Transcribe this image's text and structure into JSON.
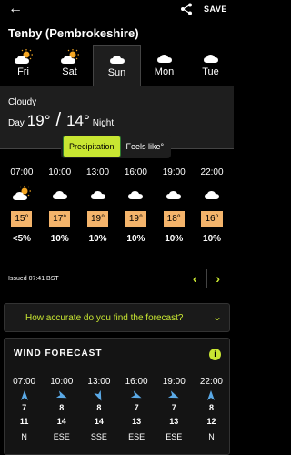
{
  "header": {
    "save_label": "SAVE"
  },
  "location": "Tenby (Pembrokeshire)",
  "days": [
    {
      "label": "Fri",
      "icon": "sun-cloud-icon"
    },
    {
      "label": "Sat",
      "icon": "sun-cloud-icon"
    },
    {
      "label": "Sun",
      "icon": "cloud-icon",
      "active": true
    },
    {
      "label": "Mon",
      "icon": "cloud-icon"
    },
    {
      "label": "Tue",
      "icon": "cloud-icon"
    }
  ],
  "summary": {
    "condition": "Cloudy",
    "day_label": "Day",
    "day_temp": "19°",
    "night_temp": "14°",
    "night_label": "Night"
  },
  "toggle": {
    "precip_label": "Precipitation",
    "feels_label": "Feels like°"
  },
  "hourly": [
    {
      "time": "07:00",
      "icon": "sun-cloud-icon",
      "temp": "15°",
      "precip": "<5%"
    },
    {
      "time": "10:00",
      "icon": "cloud-icon",
      "temp": "17°",
      "precip": "10%"
    },
    {
      "time": "13:00",
      "icon": "cloud-icon",
      "temp": "19°",
      "precip": "10%"
    },
    {
      "time": "16:00",
      "icon": "cloud-icon",
      "temp": "19°",
      "precip": "10%"
    },
    {
      "time": "19:00",
      "icon": "cloud-icon",
      "temp": "18°",
      "precip": "10%"
    },
    {
      "time": "22:00",
      "icon": "cloud-icon",
      "temp": "16°",
      "precip": "10%"
    }
  ],
  "issued": "Issued 07:41 BST",
  "accuracy_prompt": "How accurate do you find the forecast?",
  "wind": {
    "title": "WIND FORECAST",
    "hours": [
      {
        "time": "07:00",
        "speed": "7",
        "gust": "11",
        "dir": "N"
      },
      {
        "time": "10:00",
        "speed": "8",
        "gust": "14",
        "dir": "ESE"
      },
      {
        "time": "13:00",
        "speed": "8",
        "gust": "14",
        "dir": "SSE"
      },
      {
        "time": "16:00",
        "speed": "7",
        "gust": "13",
        "dir": "ESE"
      },
      {
        "time": "19:00",
        "speed": "7",
        "gust": "13",
        "dir": "ESE"
      },
      {
        "time": "22:00",
        "speed": "8",
        "gust": "12",
        "dir": "N"
      }
    ]
  },
  "colors": {
    "accent": "#c8e632",
    "temp_box": "#f4b46b",
    "panel": "#1e1e1e"
  }
}
